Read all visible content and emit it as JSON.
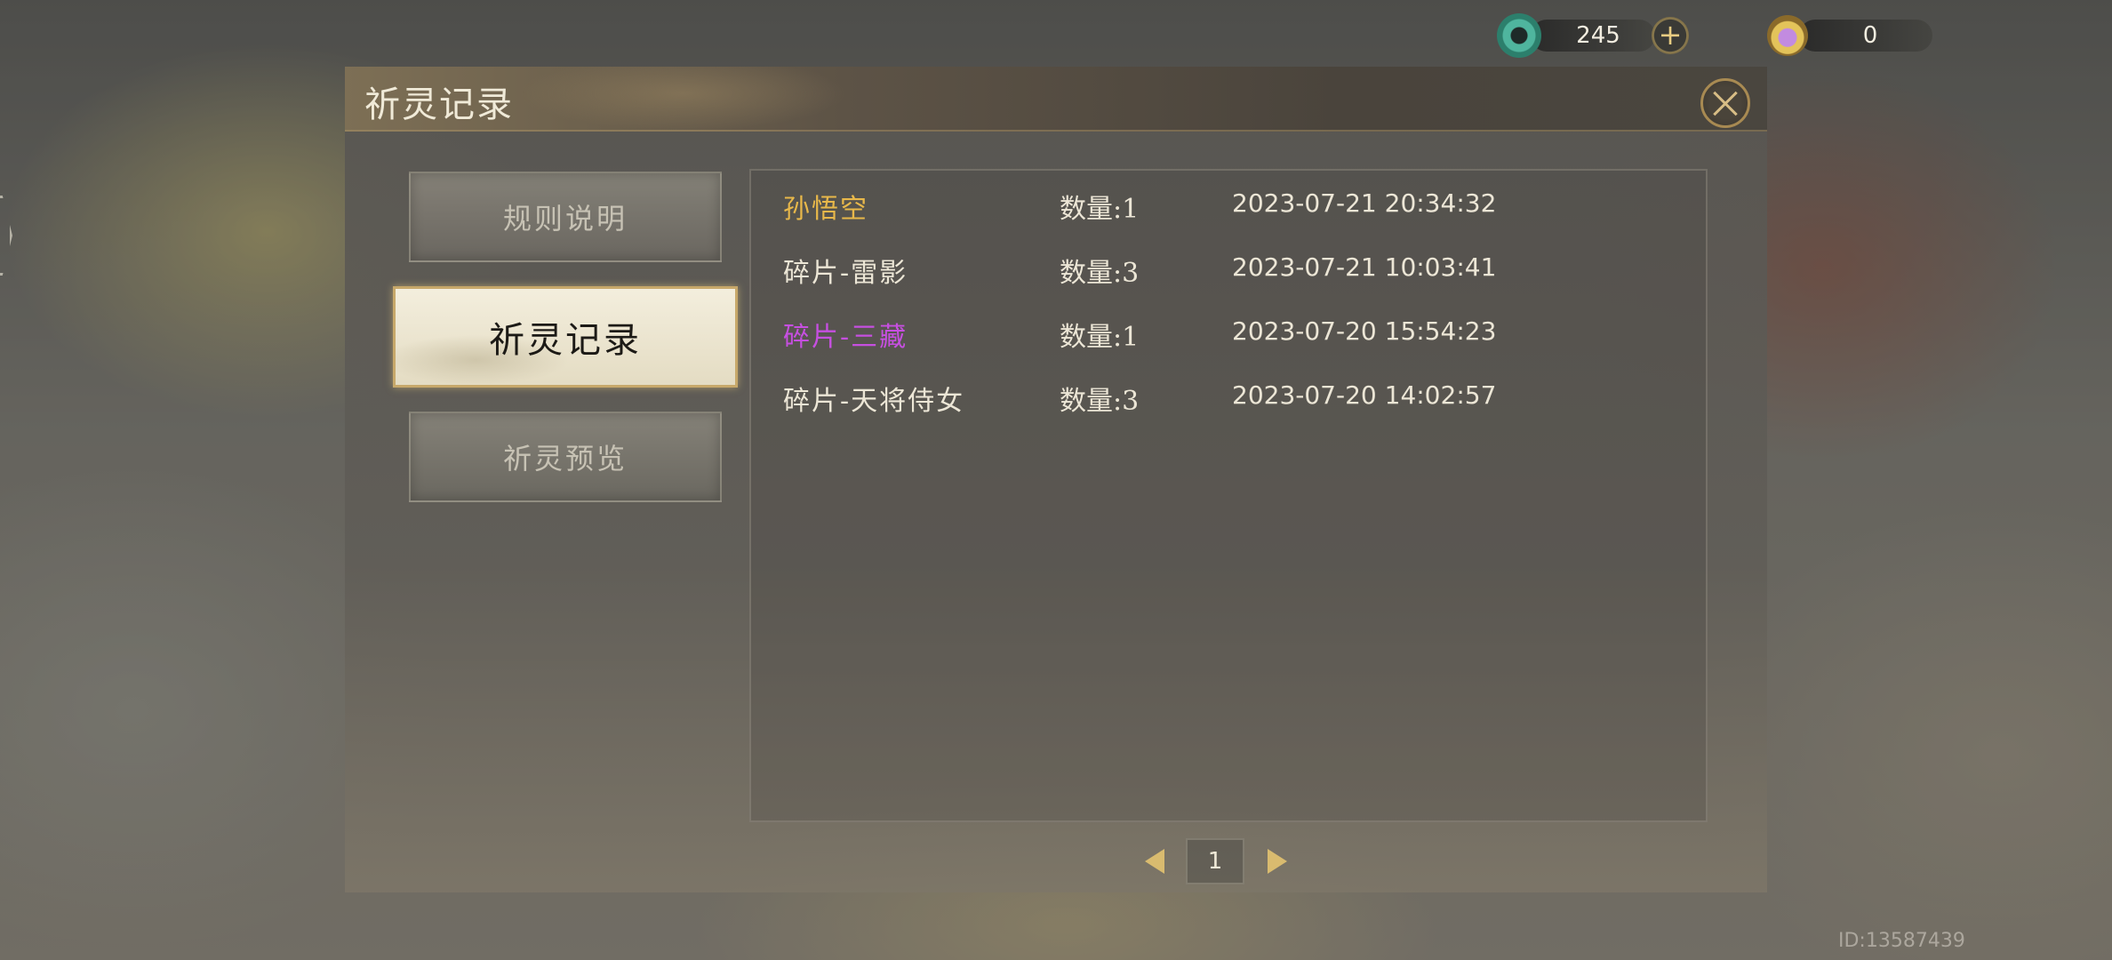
{
  "currency": {
    "jade": {
      "icon": "jade-ring-icon",
      "value": "245",
      "add_label": "+"
    },
    "lotus": {
      "icon": "lotus-orb-icon",
      "value": "0"
    }
  },
  "dialog": {
    "title": "祈灵记录",
    "close_icon": "close-icon"
  },
  "tabs": [
    {
      "label": "规则说明",
      "active": false
    },
    {
      "label": "祈灵记录",
      "active": true
    },
    {
      "label": "祈灵预览",
      "active": false
    }
  ],
  "records": [
    {
      "name": "孙悟空",
      "qty": "数量:1",
      "time": "2023-07-21 20:34:32",
      "color": "#e8b84a"
    },
    {
      "name": "碎片-雷影",
      "qty": "数量:3",
      "time": "2023-07-21 10:03:41",
      "color": "#ece6d6"
    },
    {
      "name": "碎片-三藏",
      "qty": "数量:1",
      "time": "2023-07-20 15:54:23",
      "color": "#c64fe0"
    },
    {
      "name": "碎片-天将侍女",
      "qty": "数量:3",
      "time": "2023-07-20 14:02:57",
      "color": "#ece6d6"
    }
  ],
  "pager": {
    "page": "1"
  },
  "footer": {
    "user_id": "ID:13587439"
  }
}
